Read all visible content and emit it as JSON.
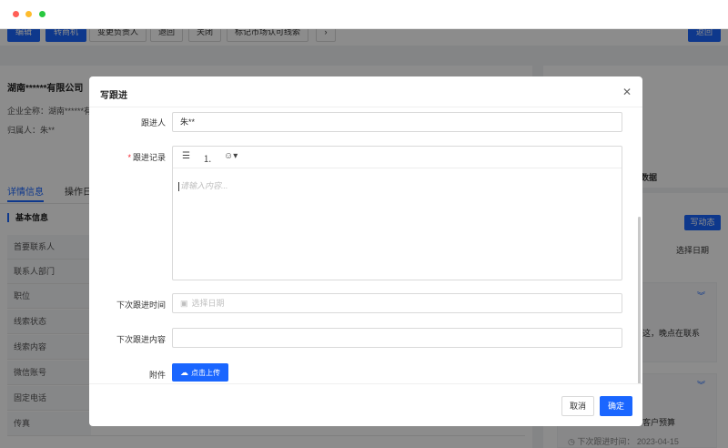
{
  "toolbar": {
    "buttons": [
      "编辑",
      "转商机",
      "变更负责人",
      "退回",
      "关闭",
      "标记市场认可线索"
    ],
    "more_icon": "chevron-right-icon",
    "back_label": "返回"
  },
  "company": {
    "name": "湖南******有限公司",
    "full_name": "企业全称：湖南******有",
    "owner": "归属人：朱**"
  },
  "tabs": [
    "详情信息",
    "操作日"
  ],
  "basic_info": {
    "title": "基本信息",
    "fields": [
      "首要联系人",
      "联系人部门",
      "职位",
      "线索状态",
      "线索内容",
      "微信账号",
      "固定电话",
      "传真"
    ]
  },
  "right_panel": {
    "data_label": "数据",
    "write_button": "写动态",
    "date_select": "选择日期",
    "snippet1": "这，晚点在联系",
    "snippet2": "客户预算",
    "next_followup": "◷ 下次跟进时间：  2023-04-15"
  },
  "modal": {
    "title": "写跟进",
    "close_icon": "close-icon",
    "follower_label": "跟进人",
    "follower_value": "朱**",
    "record_label": "跟进记录",
    "record_placeholder": "请输入内容...",
    "editor_tools": {
      "bullet": "bullet-list-icon",
      "ordered": "ordered-list-icon",
      "emoji": "emoji-icon"
    },
    "next_time_label": "下次跟进时间",
    "next_time_placeholder": "选择日期",
    "next_content_label": "下次跟进内容",
    "attachment_label": "附件",
    "upload_button": "点击上传",
    "cancel_button": "取消",
    "ok_button": "确定"
  },
  "colors": {
    "primary": "#1a66ff",
    "required": "#f5222d"
  }
}
